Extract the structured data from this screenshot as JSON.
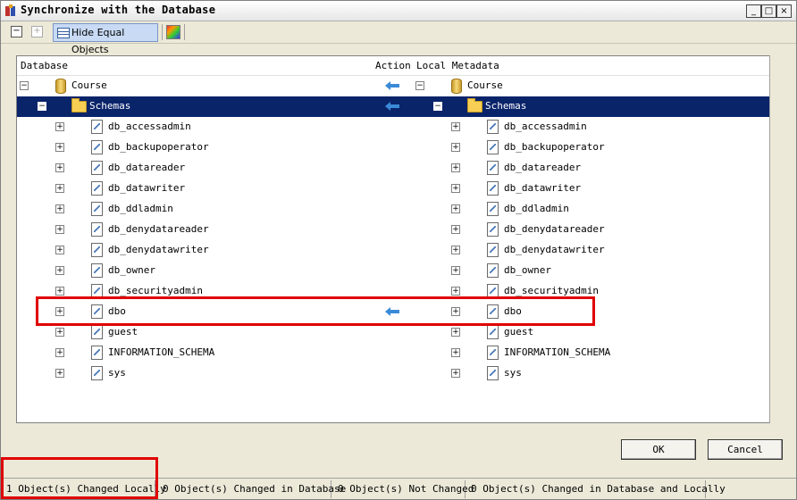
{
  "window": {
    "title": "Synchronize with the Database"
  },
  "toolbar": {
    "hide_equal_label": "Hide Equal Objects"
  },
  "columns": {
    "database": "Database",
    "action": "Action",
    "local": "Local Metadata"
  },
  "tree": {
    "root": {
      "left": "Course",
      "right": "Course"
    },
    "schemas": {
      "left": "Schemas",
      "right": "Schemas"
    },
    "items": [
      {
        "left": "db_accessadmin",
        "right": "db_accessadmin"
      },
      {
        "left": "db_backupoperator",
        "right": "db_backupoperator"
      },
      {
        "left": "db_datareader",
        "right": "db_datareader"
      },
      {
        "left": "db_datawriter",
        "right": "db_datawriter"
      },
      {
        "left": "db_ddladmin",
        "right": "db_ddladmin"
      },
      {
        "left": "db_denydatareader",
        "right": "db_denydatareader"
      },
      {
        "left": "db_denydatawriter",
        "right": "db_denydatawriter"
      },
      {
        "left": "db_owner",
        "right": "db_owner"
      },
      {
        "left": "db_securityadmin",
        "right": "db_securityadmin"
      },
      {
        "left": "dbo",
        "right": "dbo"
      },
      {
        "left": "guest",
        "right": "guest"
      },
      {
        "left": "INFORMATION_SCHEMA",
        "right": "INFORMATION_SCHEMA"
      },
      {
        "left": "sys",
        "right": "sys"
      }
    ]
  },
  "buttons": {
    "ok": "OK",
    "cancel": "Cancel"
  },
  "status": [
    "1 Object(s) Changed Locally",
    "0 Object(s) Changed in Database",
    "0 Object(s) Not Changed",
    "0 Object(s) Changed in Database and Locally"
  ],
  "colors": {
    "selection": "#0a246a",
    "highlight": "#e00000",
    "arrow": "#3a8ad8"
  }
}
